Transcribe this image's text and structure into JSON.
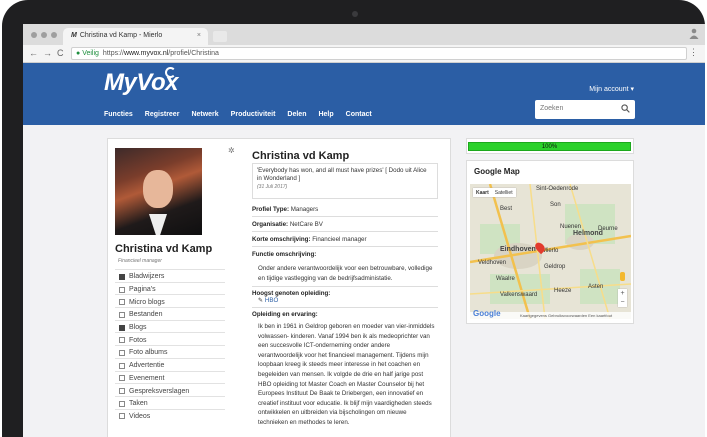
{
  "browser": {
    "tab_title": "Christina vd Kamp - Mierlo",
    "tab_favicon": "M",
    "tab_close": "×",
    "back": "←",
    "forward": "→",
    "reload": "C",
    "secure_label": "Veilig",
    "url_scheme": "https://",
    "url_host": "www.myvox.nl",
    "url_path": "/profiel/Christina",
    "menu": "⋮"
  },
  "site": {
    "logo": "MyVox",
    "account_label": "Mijn account ▾",
    "search_placeholder": "Zoeken",
    "nav": [
      "Functies",
      "Registreer",
      "Netwerk",
      "Productiviteit",
      "Delen",
      "Help",
      "Contact"
    ]
  },
  "profile": {
    "name": "Christina vd Kamp",
    "role": "Financieel manager",
    "settings_icon": "✲",
    "sidebar": [
      {
        "label": "Bladwijzers",
        "icon": "bookmark-icon"
      },
      {
        "label": "Pagina's",
        "icon": "page-icon"
      },
      {
        "label": "Micro blogs",
        "icon": "microblog-icon"
      },
      {
        "label": "Bestanden",
        "icon": "folder-icon"
      },
      {
        "label": "Blogs",
        "icon": "blog-icon"
      },
      {
        "label": "Fotos",
        "icon": "photo-icon"
      },
      {
        "label": "Foto albums",
        "icon": "album-icon"
      },
      {
        "label": "Advertentie",
        "icon": "ad-icon"
      },
      {
        "label": "Evenement",
        "icon": "calendar-icon"
      },
      {
        "label": "Gespreksverslagen",
        "icon": "report-icon"
      },
      {
        "label": "Taken",
        "icon": "task-icon"
      },
      {
        "label": "Videos",
        "icon": "video-icon"
      }
    ],
    "title": "Christina vd Kamp",
    "quote": "'Everybody has won, and all must have prizes' [ Dodo uit Alice in Wonderland ]",
    "quote_date": "(31 Juli 2017)",
    "profile_type_label": "Profiel Type:",
    "profile_type": "Managers",
    "organisation_label": "Organisatie:",
    "organisation": "NetCare BV",
    "short_desc_label": "Korte omschrijving:",
    "short_desc": "Financieel manager",
    "function_desc_label": "Functie omschrijving:",
    "function_desc": "Onder andere verantwoordelijk voor een betrouwbare, volledige en tijdige vastlegging van de bedrijfsadministatie.",
    "education_label": "Hoogst genoten opleiding:",
    "education": "HBO",
    "experience_label": "Opleiding en ervaring:",
    "experience": "Ik ben in 1961 in Geldrop geboren en moeder van vier-inmiddels volwassen- kinderen. Vanaf 1994 ben ik als medeoprichter van een succesvolle ICT-onderneming onder andere verantwoordelijk voor het financieel management. Tijdens mijn loopbaan kreeg ik steeds meer interesse in het coachen en begeleiden van mensen. Ik volgde de drie en half jarige post HBO opleiding tot Master Coach en Master Counselor bij het Europees Instituut De Baak te Driebergen, een innovatief en creatief instituut voor educatie. Ik blijf mijn vaardigheden steeds ontwikkelen en uitbreiden via bijscholingen om nieuwe technieken en methodes te leren."
  },
  "right": {
    "progress_label": "100%",
    "progress_value": 100,
    "map_title": "Google Map",
    "map_type_map": "Kaart",
    "map_type_sat": "Satelliet",
    "map_places": [
      "Sint-Oedenrode",
      "Son",
      "Best",
      "Nuenen",
      "Helmond",
      "Eindhoven",
      "Mierlo",
      "Geldrop",
      "Veldhoven",
      "Waalre",
      "Valkenswaard",
      "Heeze",
      "Deurne",
      "Asten"
    ],
    "zoom_in": "+",
    "zoom_out": "−",
    "map_footer": "Kaartgegevens  Gebruiksvoorwaarden  Een kaartfout rapporteren",
    "google_logo": "Google"
  },
  "colors": {
    "header": "#2b5ea5",
    "progress": "#2bd12b",
    "link": "#2b5ea5"
  }
}
